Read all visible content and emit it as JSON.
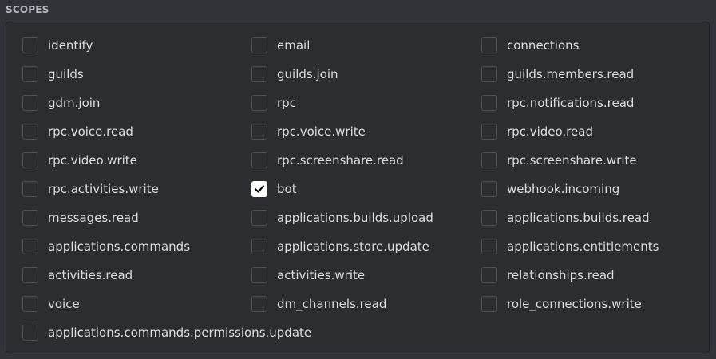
{
  "section": {
    "label": "SCOPES"
  },
  "icons": {
    "check": "checkmark-icon"
  },
  "colors": {
    "checked_bg": "#ffffff",
    "panel_bg": "#2b2d31",
    "page_bg": "#313338"
  },
  "scopes": [
    {
      "label": "identify",
      "checked": false
    },
    {
      "label": "email",
      "checked": false
    },
    {
      "label": "connections",
      "checked": false
    },
    {
      "label": "guilds",
      "checked": false
    },
    {
      "label": "guilds.join",
      "checked": false
    },
    {
      "label": "guilds.members.read",
      "checked": false
    },
    {
      "label": "gdm.join",
      "checked": false
    },
    {
      "label": "rpc",
      "checked": false
    },
    {
      "label": "rpc.notifications.read",
      "checked": false
    },
    {
      "label": "rpc.voice.read",
      "checked": false
    },
    {
      "label": "rpc.voice.write",
      "checked": false
    },
    {
      "label": "rpc.video.read",
      "checked": false
    },
    {
      "label": "rpc.video.write",
      "checked": false
    },
    {
      "label": "rpc.screenshare.read",
      "checked": false
    },
    {
      "label": "rpc.screenshare.write",
      "checked": false
    },
    {
      "label": "rpc.activities.write",
      "checked": false
    },
    {
      "label": "bot",
      "checked": true
    },
    {
      "label": "webhook.incoming",
      "checked": false
    },
    {
      "label": "messages.read",
      "checked": false
    },
    {
      "label": "applications.builds.upload",
      "checked": false
    },
    {
      "label": "applications.builds.read",
      "checked": false
    },
    {
      "label": "applications.commands",
      "checked": false
    },
    {
      "label": "applications.store.update",
      "checked": false
    },
    {
      "label": "applications.entitlements",
      "checked": false
    },
    {
      "label": "activities.read",
      "checked": false
    },
    {
      "label": "activities.write",
      "checked": false
    },
    {
      "label": "relationships.read",
      "checked": false
    },
    {
      "label": "voice",
      "checked": false
    },
    {
      "label": "dm_channels.read",
      "checked": false
    },
    {
      "label": "role_connections.write",
      "checked": false
    },
    {
      "label": "applications.commands.permissions.update",
      "checked": false
    }
  ]
}
